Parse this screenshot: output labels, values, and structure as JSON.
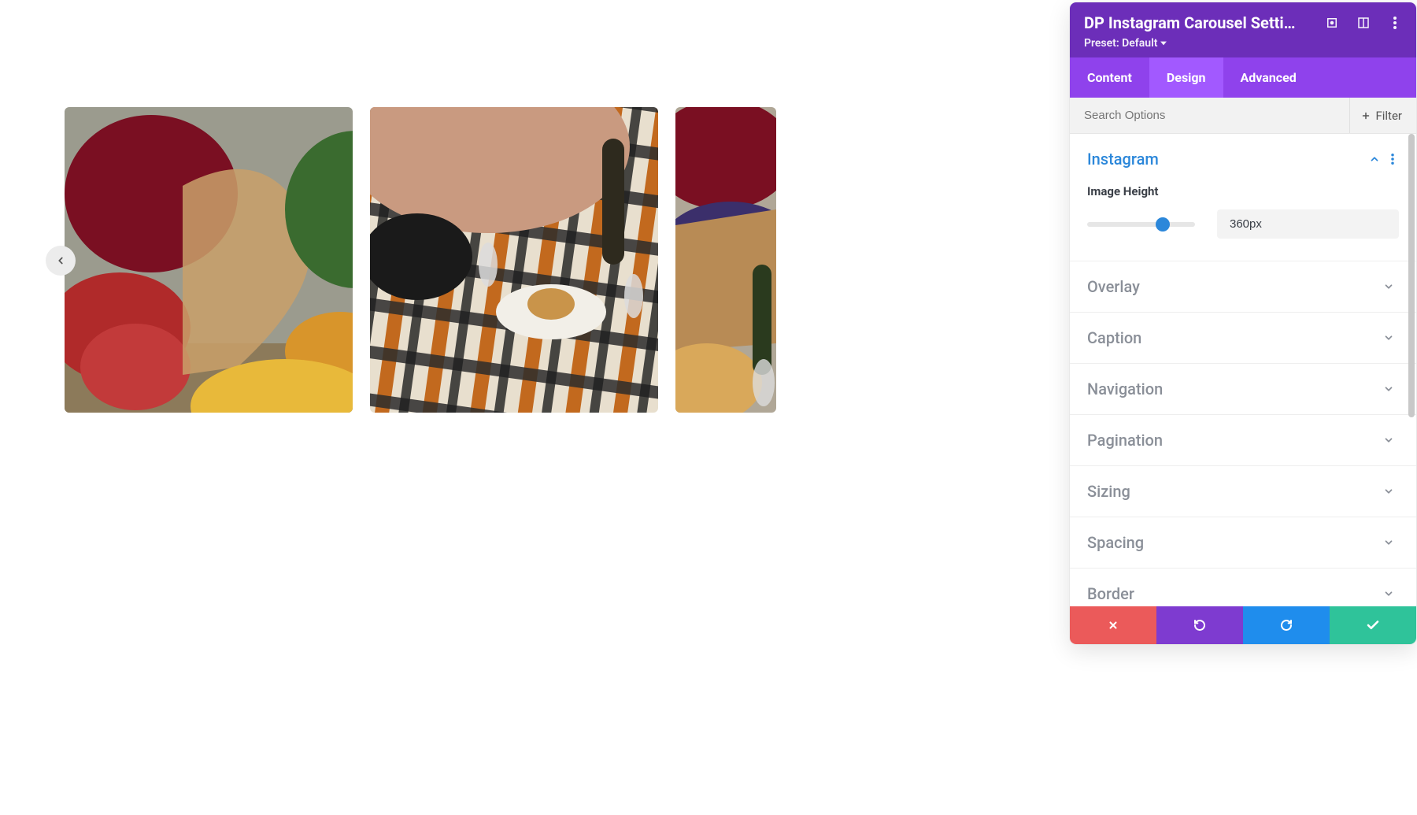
{
  "panel": {
    "title": "DP Instagram Carousel Setti…",
    "preset": "Preset: Default",
    "tabs": [
      {
        "label": "Content"
      },
      {
        "label": "Design"
      },
      {
        "label": "Advanced"
      }
    ],
    "search_placeholder": "Search Options",
    "filter_label": "Filter"
  },
  "sections": {
    "instagram": {
      "title": "Instagram",
      "expanded": true,
      "field_label": "Image Height",
      "slider_value": "360px",
      "slider_pct": 70
    },
    "collapsed": [
      {
        "key": "overlay",
        "title": "Overlay"
      },
      {
        "key": "caption",
        "title": "Caption"
      },
      {
        "key": "navigation",
        "title": "Navigation"
      },
      {
        "key": "pagination",
        "title": "Pagination"
      },
      {
        "key": "sizing",
        "title": "Sizing"
      },
      {
        "key": "spacing",
        "title": "Spacing"
      },
      {
        "key": "border",
        "title": "Border"
      }
    ]
  },
  "carousel": {
    "nav_prev": "‹"
  },
  "colors": {
    "header": "#6c2eb9",
    "tab_bg": "#8f42ec",
    "tab_active": "#a259ff",
    "accent": "#2b87da",
    "cancel": "#eb5a5a",
    "undo": "#7e3bd0",
    "redo": "#1f8ded",
    "save": "#2fc39a"
  }
}
